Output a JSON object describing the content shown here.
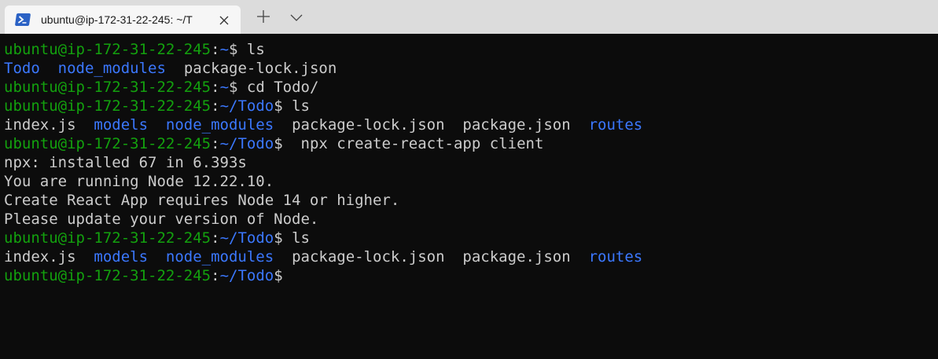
{
  "colors": {
    "background": "#0c0c0c",
    "foreground": "#cccccc",
    "user_host": "#13a10e",
    "path": "#3b78ff",
    "directory": "#3b78ff",
    "tab_bar": "#dcdcdc",
    "tab_active": "#f6f6f6"
  },
  "tab": {
    "title": "ubuntu@ip-172-31-22-245: ~/T",
    "icon": "powershell-icon",
    "close_icon": "close-icon"
  },
  "tabbar": {
    "new_tab_icon": "plus-icon",
    "dropdown_icon": "chevron-down-icon"
  },
  "terminal": {
    "user_host": "ubuntu@ip-172-31-22-245",
    "lines": [
      {
        "type": "prompt",
        "path": "~",
        "cmd": " ls"
      },
      {
        "type": "output",
        "segments": [
          {
            "text": "Todo",
            "dir": true
          },
          {
            "text": "  ",
            "dir": false
          },
          {
            "text": "node_modules",
            "dir": true
          },
          {
            "text": "  package-lock.json",
            "dir": false
          }
        ]
      },
      {
        "type": "prompt",
        "path": "~",
        "cmd": " cd Todo/"
      },
      {
        "type": "prompt",
        "path": "~/Todo",
        "cmd": " ls"
      },
      {
        "type": "output",
        "segments": [
          {
            "text": "index.js  ",
            "dir": false
          },
          {
            "text": "models",
            "dir": true
          },
          {
            "text": "  ",
            "dir": false
          },
          {
            "text": "node_modules",
            "dir": true
          },
          {
            "text": "  package-lock.json  package.json  ",
            "dir": false
          },
          {
            "text": "routes",
            "dir": true
          }
        ]
      },
      {
        "type": "prompt",
        "path": "~/Todo",
        "cmd": "  npx create-react-app client"
      },
      {
        "type": "output",
        "segments": [
          {
            "text": "npx: installed 67 in 6.393s",
            "dir": false
          }
        ]
      },
      {
        "type": "output",
        "segments": [
          {
            "text": "You are running Node 12.22.10.",
            "dir": false
          }
        ]
      },
      {
        "type": "output",
        "segments": [
          {
            "text": "Create React App requires Node 14 or higher.",
            "dir": false
          }
        ]
      },
      {
        "type": "output",
        "segments": [
          {
            "text": "Please update your version of Node.",
            "dir": false
          }
        ]
      },
      {
        "type": "prompt",
        "path": "~/Todo",
        "cmd": " ls"
      },
      {
        "type": "output",
        "segments": [
          {
            "text": "index.js  ",
            "dir": false
          },
          {
            "text": "models",
            "dir": true
          },
          {
            "text": "  ",
            "dir": false
          },
          {
            "text": "node_modules",
            "dir": true
          },
          {
            "text": "  package-lock.json  package.json  ",
            "dir": false
          },
          {
            "text": "routes",
            "dir": true
          }
        ]
      },
      {
        "type": "prompt",
        "path": "~/Todo",
        "cmd": ""
      }
    ]
  }
}
